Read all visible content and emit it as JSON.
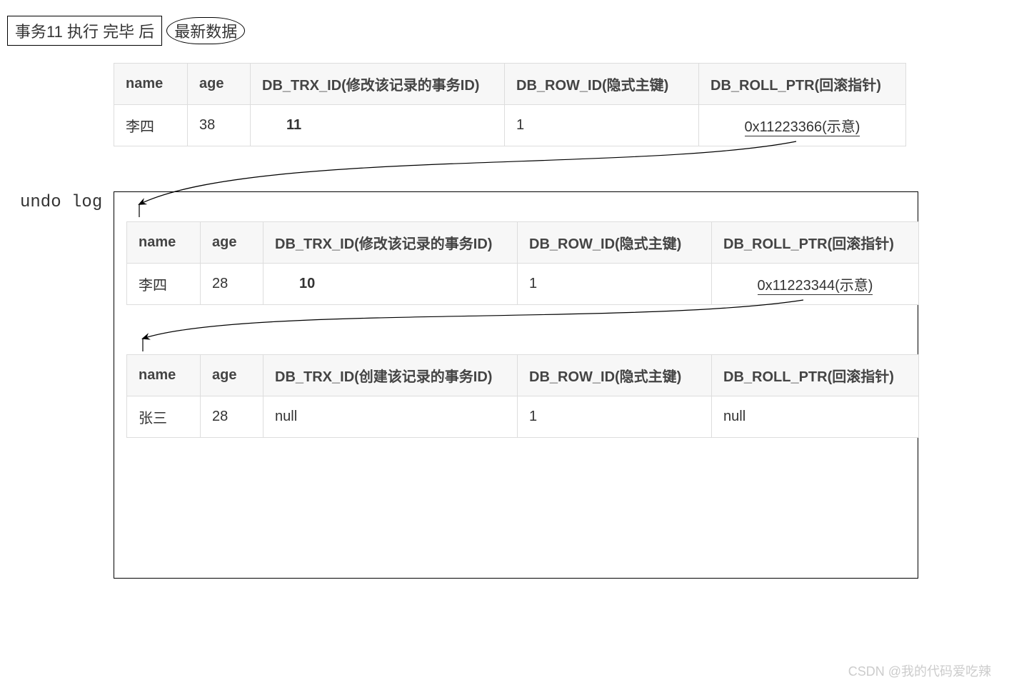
{
  "title": "事务11 执行 完毕 后",
  "latest_badge": "最新数据",
  "undo_label": "undo log",
  "watermark": "CSDN @我的代码爱吃辣",
  "columns_modify": {
    "name": "name",
    "age": "age",
    "trx": "DB_TRX_ID(修改该记录的事务ID)",
    "row": "DB_ROW_ID(隐式主键)",
    "roll": "DB_ROLL_PTR(回滚指针)"
  },
  "columns_create": {
    "name": "name",
    "age": "age",
    "trx": "DB_TRX_ID(创建该记录的事务ID)",
    "row": "DB_ROW_ID(隐式主键)",
    "roll": "DB_ROLL_PTR(回滚指针)"
  },
  "current": {
    "name": "李四",
    "age": "38",
    "trx": "11",
    "row": "1",
    "roll": "0x11223366(示意)"
  },
  "undo1": {
    "name": "李四",
    "age": "28",
    "trx": "10",
    "row": "1",
    "roll": "0x11223344(示意)"
  },
  "undo2": {
    "name": "张三",
    "age": "28",
    "trx": "null",
    "row": "1",
    "roll": "null"
  }
}
